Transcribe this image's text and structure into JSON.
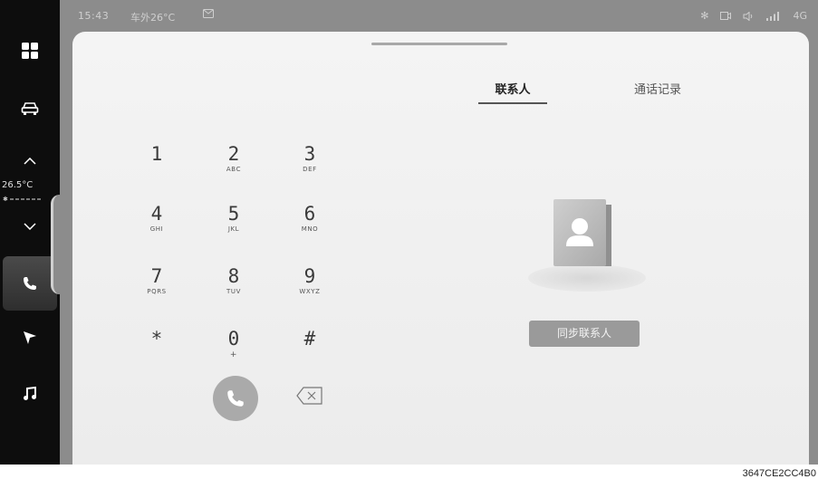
{
  "status_bar": {
    "time": "15:43",
    "outside_temp": "车外26°C",
    "network": "4G"
  },
  "sidebar": {
    "cabin_temp": "26.5°C",
    "items": [
      {
        "icon": "apps-grid-icon"
      },
      {
        "icon": "car-icon"
      },
      {
        "icon": "chevron-up-icon"
      },
      {
        "icon": "chevron-down-icon"
      },
      {
        "icon": "phone-icon",
        "active": true
      },
      {
        "icon": "navigation-arrow-icon"
      },
      {
        "icon": "music-note-icon"
      }
    ]
  },
  "tabs": {
    "contacts": "联系人",
    "call_history": "通话记录"
  },
  "dialpad": {
    "keys": [
      {
        "digit": "1",
        "letters": ""
      },
      {
        "digit": "2",
        "letters": "ABC"
      },
      {
        "digit": "3",
        "letters": "DEF"
      },
      {
        "digit": "4",
        "letters": "GHI"
      },
      {
        "digit": "5",
        "letters": "JKL"
      },
      {
        "digit": "6",
        "letters": "MNO"
      },
      {
        "digit": "7",
        "letters": "PQRS"
      },
      {
        "digit": "8",
        "letters": "TUV"
      },
      {
        "digit": "9",
        "letters": "WXYZ"
      },
      {
        "digit": "*",
        "letters": ""
      },
      {
        "digit": "0",
        "letters": "+"
      },
      {
        "digit": "#",
        "letters": ""
      }
    ]
  },
  "contacts_panel": {
    "sync_button": "同步联系人"
  },
  "footer": {
    "code": "3647CE2CC4B0"
  },
  "colors": {
    "sidebar_bg": "#0d0d0d",
    "frame_bg": "#8c8c8c",
    "panel_bg": "#f0f0f0",
    "call_button": "#aaaaaa",
    "sync_button": "#9a9a9a"
  }
}
